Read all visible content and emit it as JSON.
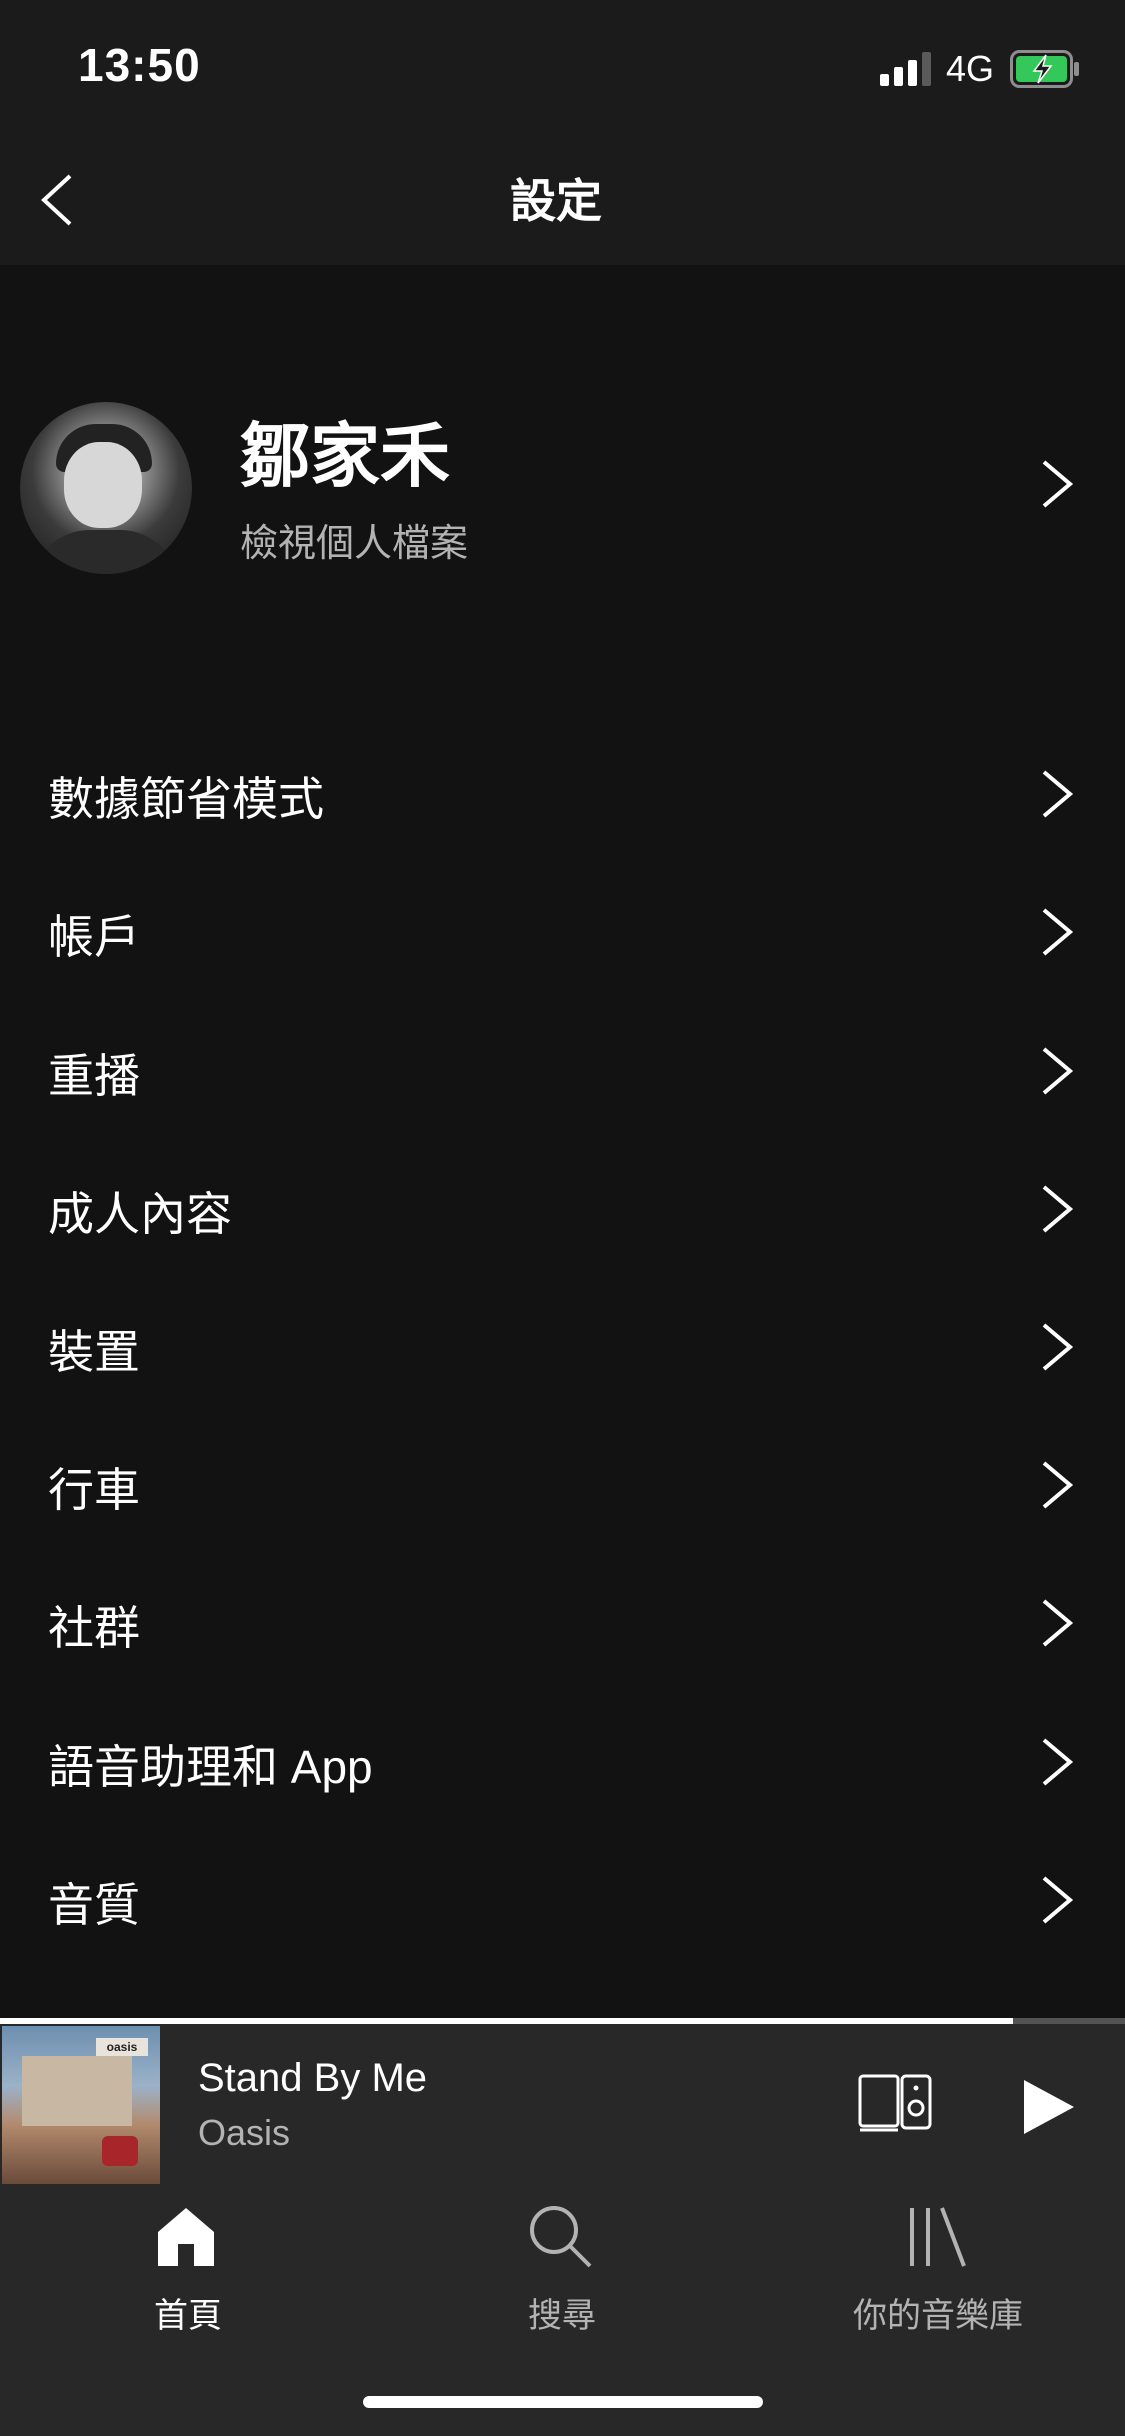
{
  "status_bar": {
    "time": "13:50",
    "network": "4G",
    "icons": [
      "signal-icon",
      "battery-charging-icon"
    ]
  },
  "header": {
    "title": "設定",
    "back_icon": "chevron-left-icon"
  },
  "profile": {
    "name": "鄒家禾",
    "subtitle": "檢視個人檔案"
  },
  "settings": {
    "items": [
      {
        "label": "數據節省模式"
      },
      {
        "label": "帳戶"
      },
      {
        "label": "重播"
      },
      {
        "label": "成人內容"
      },
      {
        "label": "裝置"
      },
      {
        "label": "行車"
      },
      {
        "label": "社群"
      },
      {
        "label": "語音助理和 App"
      },
      {
        "label": "音質"
      }
    ]
  },
  "now_playing": {
    "title": "Stand By Me",
    "artist": "Oasis",
    "album_art_text": "oasis",
    "progress": 0.9,
    "devices_icon": "devices-icon",
    "play_icon": "play-icon"
  },
  "tabs": [
    {
      "label": "首頁",
      "icon": "home-icon",
      "active": true
    },
    {
      "label": "搜尋",
      "icon": "search-icon",
      "active": false
    },
    {
      "label": "你的音樂庫",
      "icon": "library-icon",
      "active": false
    }
  ],
  "colors": {
    "background": "#121212",
    "header": "#1b1b1b",
    "player": "#282828",
    "secondary_text": "#b3b3b3",
    "battery": "#34c759"
  }
}
